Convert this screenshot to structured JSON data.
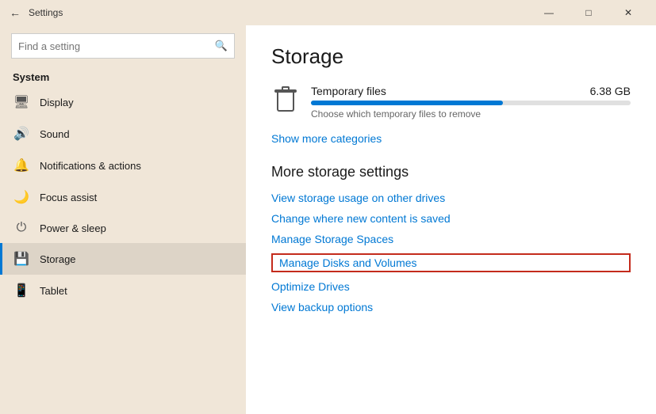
{
  "titlebar": {
    "title": "Settings",
    "back_label": "←",
    "minimize_label": "—",
    "maximize_label": "□",
    "close_label": "✕"
  },
  "sidebar": {
    "search_placeholder": "Find a setting",
    "section_title": "System",
    "items": [
      {
        "id": "display",
        "label": "Display",
        "icon": "🖥"
      },
      {
        "id": "sound",
        "label": "Sound",
        "icon": "🔊"
      },
      {
        "id": "notifications",
        "label": "Notifications & actions",
        "icon": "🔔"
      },
      {
        "id": "focus",
        "label": "Focus assist",
        "icon": "🌙"
      },
      {
        "id": "power",
        "label": "Power & sleep",
        "icon": "⏻"
      },
      {
        "id": "storage",
        "label": "Storage",
        "icon": "💾",
        "active": true
      },
      {
        "id": "tablet",
        "label": "Tablet",
        "icon": "📱"
      }
    ]
  },
  "content": {
    "title": "Storage",
    "temporary_files": {
      "name": "Temporary files",
      "size": "6.38 GB",
      "description": "Choose which temporary files to remove",
      "progress_percent": 60
    },
    "show_more": "Show more categories",
    "more_storage_settings_title": "More storage settings",
    "links": [
      {
        "id": "view-storage",
        "label": "View storage usage on other drives",
        "highlighted": false
      },
      {
        "id": "change-content",
        "label": "Change where new content is saved",
        "highlighted": false
      },
      {
        "id": "manage-spaces",
        "label": "Manage Storage Spaces",
        "highlighted": false
      },
      {
        "id": "manage-disks",
        "label": "Manage Disks and Volumes",
        "highlighted": true
      },
      {
        "id": "optimize",
        "label": "Optimize Drives",
        "highlighted": false
      },
      {
        "id": "backup",
        "label": "View backup options",
        "highlighted": false
      }
    ]
  }
}
